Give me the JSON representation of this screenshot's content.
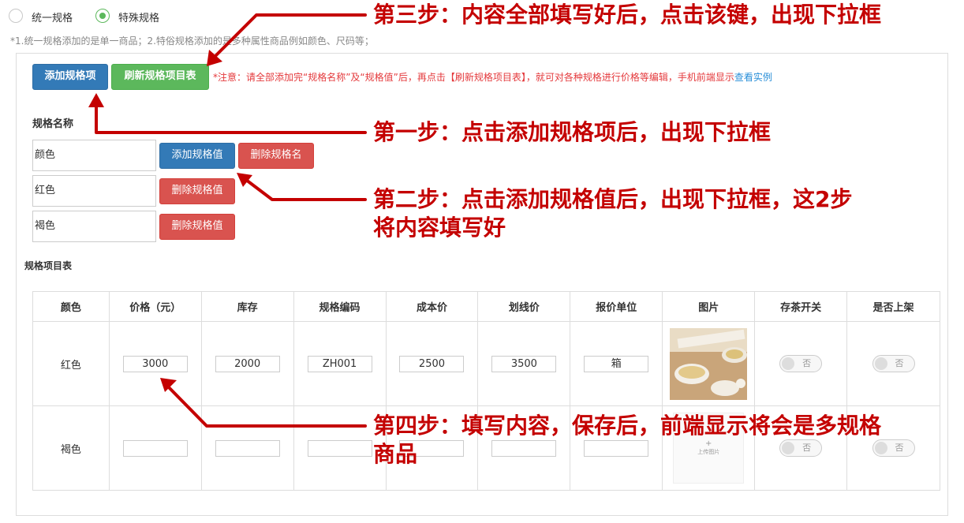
{
  "spec_mode": {
    "options": [
      {
        "label": "统一规格",
        "selected": false
      },
      {
        "label": "特殊规格",
        "selected": true
      }
    ],
    "hint": "*1.统一规格添加的是单一商品；2.特俗规格添加的是多种属性商品例如颜色、尺码等；"
  },
  "toolbar": {
    "add_spec_item": "添加规格项",
    "refresh_table": "刷新规格项目表",
    "notice": "*注意：请全部添加完“规格名称”及“规格值”后，再点击【刷新规格项目表】，就可对各种规格进行价格等编辑，手机前端显示",
    "notice_link": "查看实例"
  },
  "spec_name_section": {
    "title": "规格名称",
    "name_value": "颜色",
    "add_value_button": "添加规格值",
    "delete_name_button": "删除规格名",
    "values": [
      {
        "value": "红色",
        "delete_button": "删除规格值"
      },
      {
        "value": "褐色",
        "delete_button": "删除规格值"
      }
    ]
  },
  "spec_table": {
    "title": "规格项目表",
    "headers": [
      "颜色",
      "价格（元）",
      "库存",
      "规格编码",
      "成本价",
      "划线价",
      "报价单位",
      "图片",
      "存茶开关",
      "是否上架"
    ],
    "rows": [
      {
        "color": "红色",
        "price": "3000",
        "stock": "2000",
        "code": "ZH001",
        "cost": "2500",
        "list_price": "3500",
        "unit": "箱",
        "has_image": true,
        "tea_switch": "否",
        "on_shelf": "否"
      },
      {
        "color": "褐色",
        "price": "",
        "stock": "",
        "code": "",
        "cost": "",
        "list_price": "",
        "unit": "",
        "has_image": false,
        "upload_plus": "+",
        "upload_text": "上传图片",
        "tea_switch": "否",
        "on_shelf": "否"
      }
    ]
  },
  "annotations": {
    "step3": "第三步：内容全部填写好后，点击该键，出现下拉框",
    "step1": "第一步：点击添加规格项后，出现下拉框",
    "step2_line1": "第二步：点击添加规格值后，出现下拉框，这2步",
    "step2_line2": "将内容填写好",
    "step4_line1": "第四步：填写内容，保存后，前端显示将会是多规格",
    "step4_line2": "商品"
  },
  "colors": {
    "primary": "#337ab7",
    "success": "#5cb85c",
    "danger": "#d9534f",
    "annotation_red": "#c40000"
  }
}
